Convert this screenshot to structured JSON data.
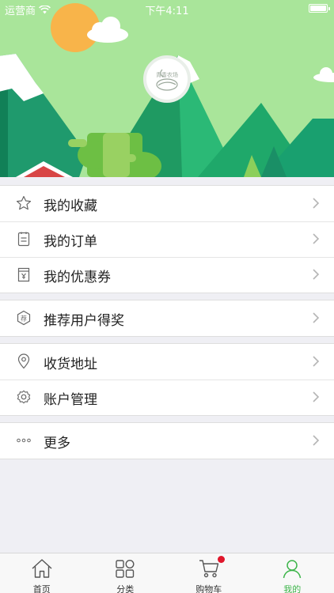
{
  "status_bar": {
    "carrier": "运营商",
    "time": "下午4:11"
  },
  "profile": {
    "avatar_text": "青青农场"
  },
  "menu": {
    "favorites": "我的收藏",
    "orders": "我的订单",
    "coupons": "我的优惠券",
    "referral": "推荐用户得奖",
    "address": "收货地址",
    "account": "账户管理",
    "more": "更多"
  },
  "tabs": {
    "home": "首页",
    "category": "分类",
    "cart": "购物车",
    "mine": "我的"
  },
  "colors": {
    "accent": "#3db54a",
    "badge": "#e0162b",
    "sky": "#a9e59a"
  }
}
